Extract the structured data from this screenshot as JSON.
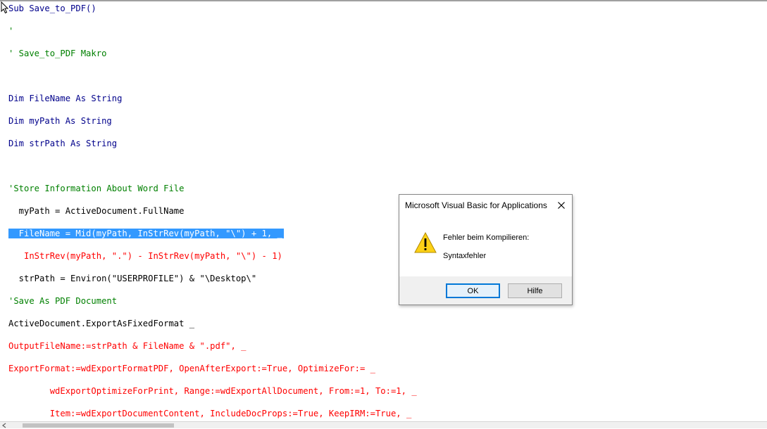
{
  "editor": {
    "lines": [
      {
        "text": "Sub Save_to_PDF()",
        "color": "blue"
      },
      {
        "text": "'",
        "color": "green"
      },
      {
        "text": "' Save_to_PDF Makro",
        "color": "green"
      },
      {
        "text": "",
        "color": "blue"
      },
      {
        "text": "Dim FileName As String",
        "color": "blue"
      },
      {
        "text": "Dim myPath As String",
        "color": "blue"
      },
      {
        "text": "Dim strPath As String",
        "color": "blue"
      },
      {
        "text": "",
        "color": "blue"
      },
      {
        "text": "'Store Information About Word File",
        "color": "green"
      },
      {
        "text": "  myPath = ActiveDocument.FullName",
        "color": "black"
      },
      {
        "text": "  FileName = Mid(myPath, InStrRev(myPath, \"\\\") + 1, _",
        "color": "selected"
      },
      {
        "text": "   InStrRev(myPath, \".\") - InStrRev(myPath, \"\\\") - 1)",
        "color": "red"
      },
      {
        "text": "  strPath = Environ(\"USERPROFILE\") & \"\\Desktop\\\"",
        "color": "black"
      },
      {
        "text": "'Save As PDF Document",
        "color": "green"
      },
      {
        "text": "ActiveDocument.ExportAsFixedFormat _",
        "color": "black"
      },
      {
        "text": "OutputFileName:=strPath & FileName & \".pdf\", _",
        "color": "red"
      },
      {
        "text": "ExportFormat:=wdExportFormatPDF, OpenAfterExport:=True, OptimizeFor:= _",
        "color": "red"
      },
      {
        "text": "        wdExportOptimizeForPrint, Range:=wdExportAllDocument, From:=1, To:=1, _",
        "color": "red"
      },
      {
        "text": "        Item:=wdExportDocumentContent, IncludeDocProps:=True, KeepIRM:=True, _",
        "color": "red"
      }
    ]
  },
  "dialog": {
    "title": "Microsoft Visual Basic for Applications",
    "heading": "Fehler beim Kompilieren:",
    "message": "Syntaxfehler",
    "ok_label": "OK",
    "help_label": "Hilfe",
    "icon": "warning-icon",
    "accent": "#0078d7"
  },
  "colors": {
    "keyword": "#00008b",
    "comment": "#008000",
    "error": "#ff0000",
    "selection": "#3399ff"
  }
}
